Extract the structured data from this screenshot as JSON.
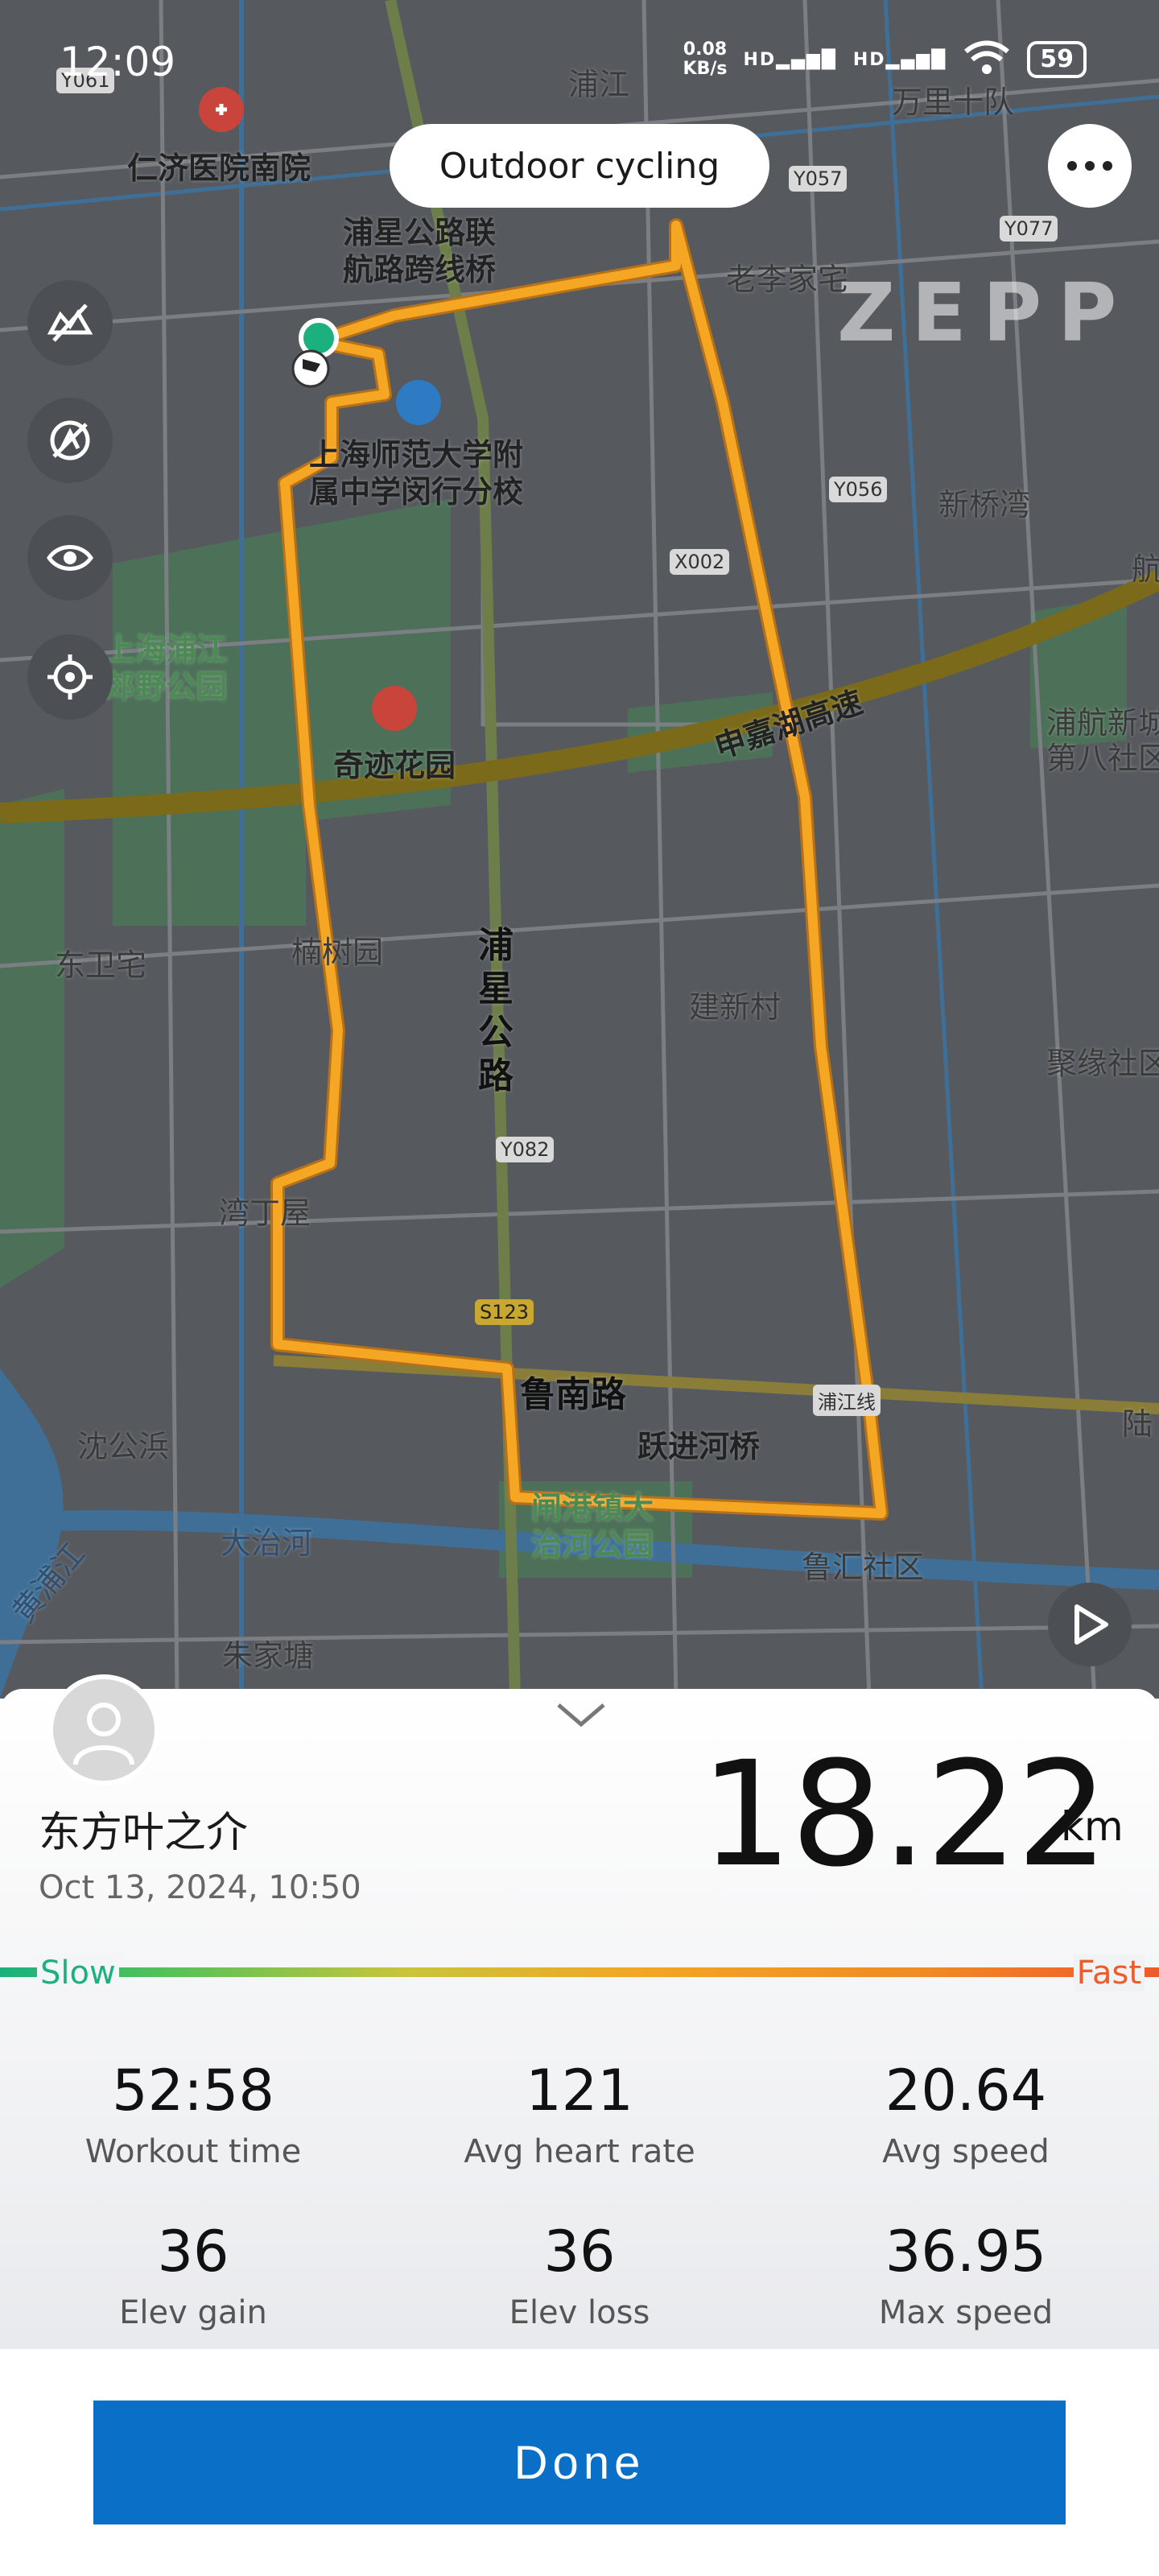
{
  "status_bar": {
    "time": "12:09",
    "net_speed_value": "0.08",
    "net_speed_unit": "KB/s",
    "signal1": "HD",
    "signal2": "HD",
    "battery": "59"
  },
  "header": {
    "title": "Outdoor cycling",
    "more_icon": "more-horizontal-icon"
  },
  "map": {
    "watermark": "ZEPP",
    "labels": {
      "pujiang": "浦江",
      "wanli": "万里十队",
      "renji": "仁济医院南院",
      "puxing_bridge": "浦星公路联\n航路跨线桥",
      "laolijia": "老李家宅",
      "school": "上海师范大学附\n属中学闵行分校",
      "xinqiaowan": "新桥湾",
      "park": "上海浦江\n郊野公园",
      "qiji": "奇迹花园",
      "shenjia": "申嘉湖高速",
      "puhang": "浦航新城\n第八社区",
      "hang": "航",
      "dongwei": "东卫宅",
      "nanshu": "楠树园",
      "puxing_road": "浦\n星\n公\n路",
      "jianxin": "建新村",
      "juyuan": "聚缘社区",
      "wanding": "湾丁屋",
      "lunan": "鲁南路",
      "yuejin": "跃进河桥",
      "shengong": "沈公浜",
      "dazhi": "大治河",
      "dazhi_park": "闸港镇大\n治河公园",
      "luhui": "鲁汇社区",
      "zhujia": "朱家塘",
      "huangpu": "黄浦江",
      "lu": "陆",
      "pujiang_line": "浦江线"
    },
    "road_badges": {
      "y061": "Y061",
      "y057": "Y057",
      "y077": "Y077",
      "y056": "Y056",
      "x002": "X002",
      "y082": "Y082",
      "s123": "S123"
    },
    "controls": [
      "layers-off-icon",
      "compass-off-icon",
      "eye-icon",
      "locate-icon"
    ],
    "play_icon": "play-icon"
  },
  "summary": {
    "username": "东方叶之介",
    "date": "Oct 13, 2024, 10:50",
    "distance": "18.22",
    "distance_unit": "km",
    "speed_scale": {
      "slow": "Slow",
      "fast": "Fast"
    },
    "stats": [
      {
        "value": "52:58",
        "label": "Workout time"
      },
      {
        "value": "121",
        "label": "Avg heart rate"
      },
      {
        "value": "20.64",
        "label": "Avg speed"
      },
      {
        "value": "36",
        "label": "Elev gain"
      },
      {
        "value": "36",
        "label": "Elev loss"
      },
      {
        "value": "36.95",
        "label": "Max speed"
      }
    ]
  },
  "actions": {
    "done": "Done"
  },
  "colors": {
    "route": "#f5a623",
    "done_button": "#0a6fc6",
    "slow": "#1bb07e",
    "fast": "#ee5a2a"
  }
}
